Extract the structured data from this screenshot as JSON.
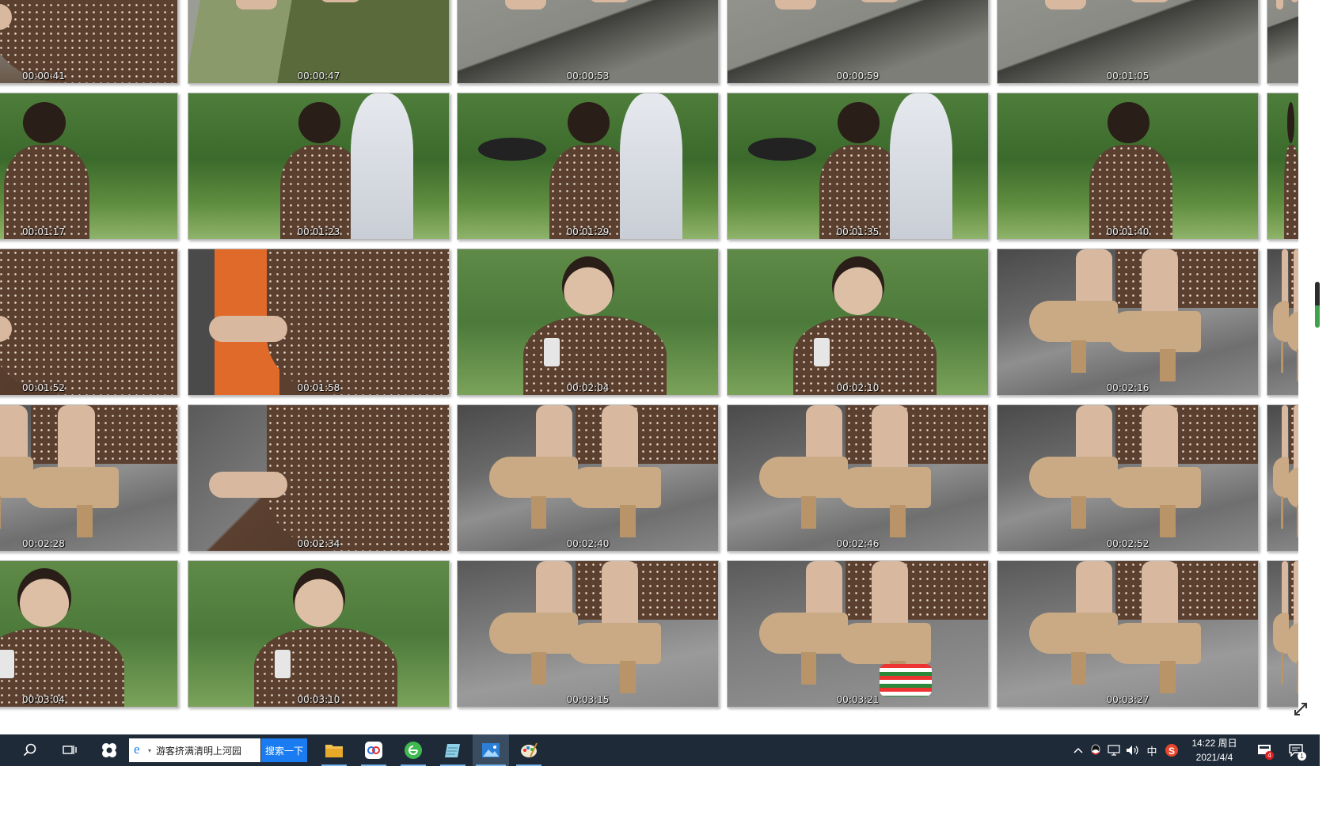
{
  "timestamps": [
    [
      "00:00:41",
      "00:00:47",
      "00:00:53",
      "00:00:59",
      "00:01:05"
    ],
    [
      "00:01:17",
      "00:01:23",
      "00:01:29",
      "00:01:35",
      "00:01:40"
    ],
    [
      "00:01:52",
      "00:01:58",
      "00:02:04",
      "00:02:10",
      "00:02:16"
    ],
    [
      "00:02:28",
      "00:02:34",
      "00:02:40",
      "00:02:46",
      "00:02:52"
    ],
    [
      "00:03:04",
      "00:03:10",
      "00:03:15",
      "00:03:21",
      "00:03:27"
    ]
  ],
  "scenes": [
    [
      "steps-dress",
      "pond-shoes",
      "pavement-shoes",
      "pavement-shoes",
      "pavement-shoes"
    ],
    [
      "park-girl",
      "park-hood",
      "park-hat",
      "park-hat",
      "park-girl"
    ],
    [
      "dress-close",
      "boy-dress",
      "phone-girl",
      "phone-girl",
      "shoes-steps"
    ],
    [
      "shoes-steps",
      "dress-close",
      "shoes-steps",
      "shoes-steps",
      "shoes-steps"
    ],
    [
      "phone-girl",
      "phone-girl",
      "shoes-ground",
      "socks-shoes",
      "shoes-ground"
    ]
  ],
  "colors": {
    "taskbar": "#1e2a38",
    "dress": "#5b4030",
    "shoe": "#c9aa85",
    "skin": "#d8b9a0",
    "stone": "#8a8a8a",
    "grass": "#3f6f2f",
    "accent": "#1a7cf0"
  },
  "taskbar": {
    "search_text": "游客挤满清明上河园",
    "search_button": "搜索一下",
    "ime": "中",
    "time": "14:22 周日",
    "date": "2021/4/4",
    "notif_badge": "4",
    "action_badge": "1",
    "icons": [
      "search-icon",
      "task-view-icon",
      "app-icon",
      "browser-icon",
      "folder-icon",
      "baidu-icon",
      "green-browser-icon",
      "notebook-icon",
      "photos-icon",
      "paint-icon"
    ]
  }
}
